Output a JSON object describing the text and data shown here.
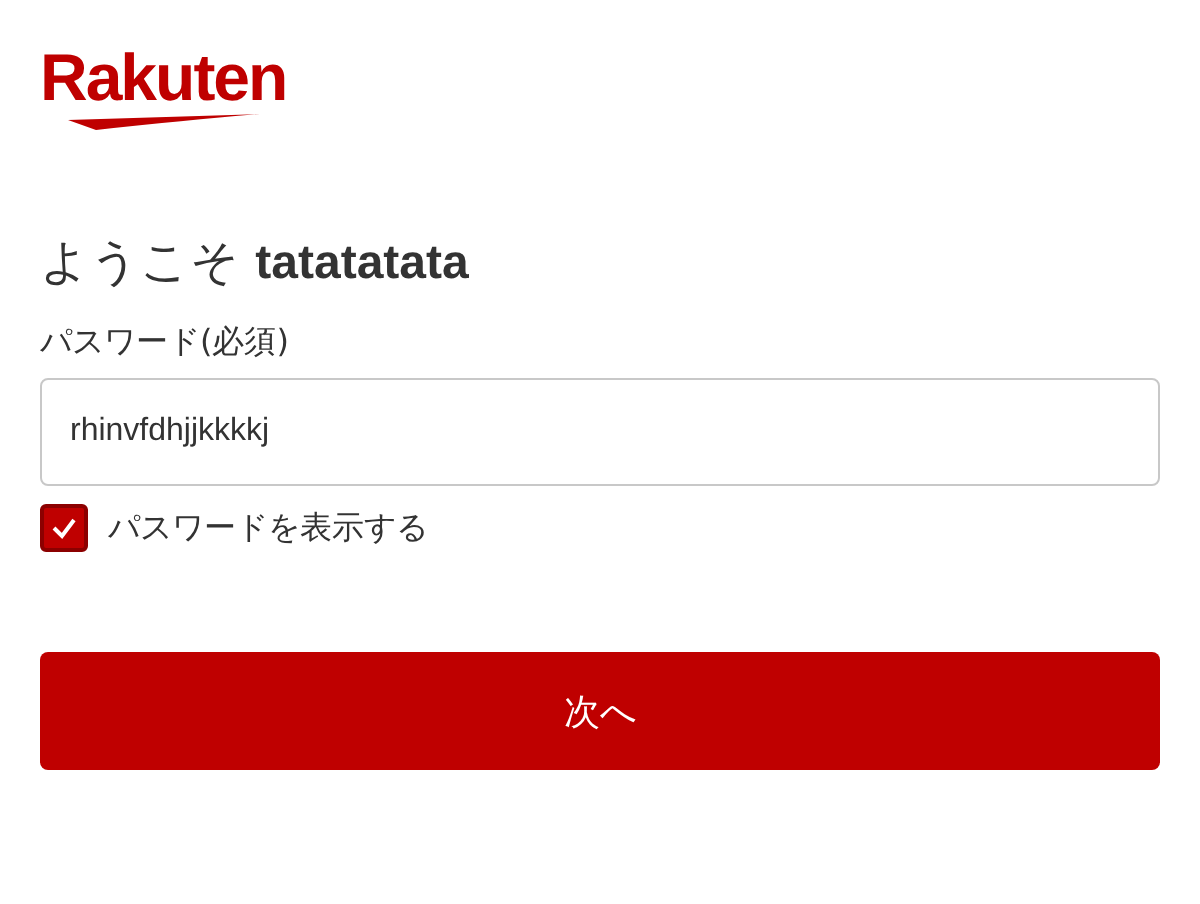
{
  "logo": {
    "text": "Rakuten"
  },
  "heading": "ようこそ **tatatatata**",
  "password": {
    "label": "パスワード(必須)",
    "value": "rhinvfdhjjkkkkj"
  },
  "show_password": {
    "label": "パスワードを表示する",
    "checked": true
  },
  "next_button": {
    "label": "次へ"
  }
}
